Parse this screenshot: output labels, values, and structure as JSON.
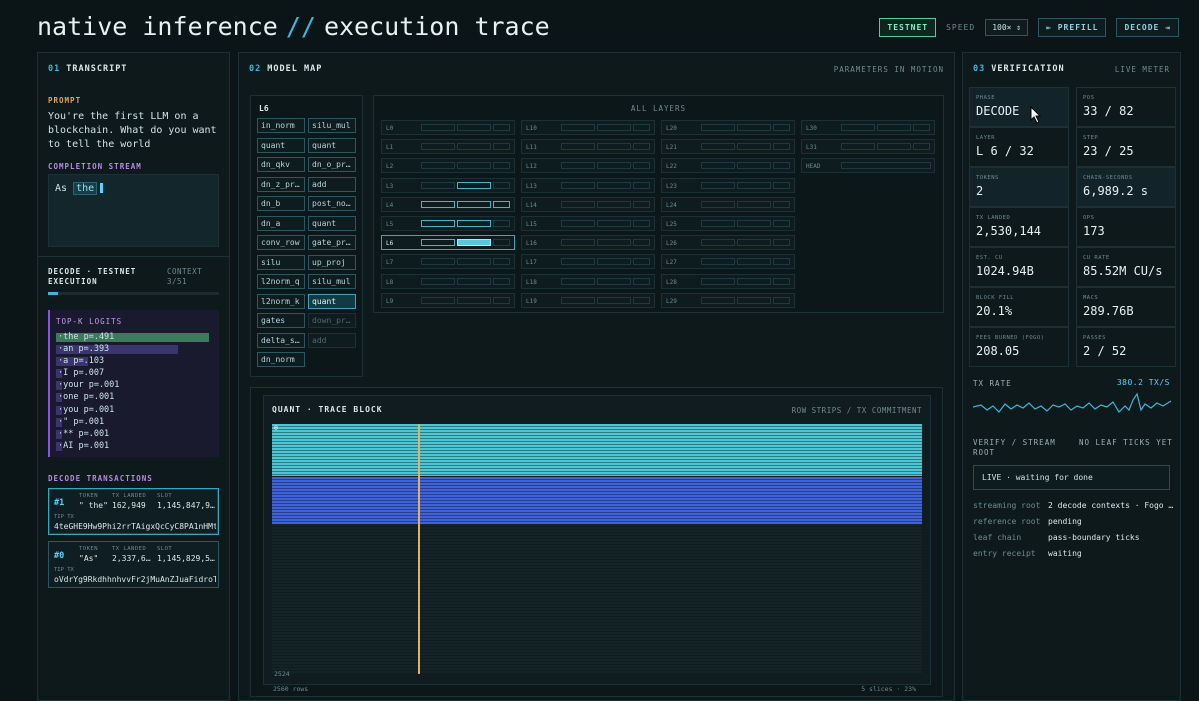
{
  "header": {
    "title_left": "native inference",
    "title_sep": "//",
    "title_right": "execution trace",
    "network": "TESTNET",
    "speed_label": "SPEED",
    "speed_value": "100× ⇕",
    "prefill_button": "⇤ PREFILL",
    "decode_button": "DECODE ⇥"
  },
  "transcript": {
    "num": "01",
    "title": "TRANSCRIPT",
    "prompt_label": "PROMPT",
    "prompt_text": "You're the first LLM on a blockchain. What do you want to tell the world",
    "completion_label": "COMPLETION STREAM",
    "completion_tokens": [
      "As",
      "the"
    ],
    "exec_label": "DECODE · TESTNET EXECUTION",
    "context_label": "CONTEXT",
    "context_value": "3/51",
    "context_fraction": 0.06,
    "topk_title": "TOP-K LOGITS",
    "topk": [
      {
        "text": "·the p=.491",
        "p": 0.491
      },
      {
        "text": "·an p=.393",
        "p": 0.393
      },
      {
        "text": "·a p=.103",
        "p": 0.103
      },
      {
        "text": "·I p=.007",
        "p": 0.007
      },
      {
        "text": "·your p=.001",
        "p": 0.001
      },
      {
        "text": "·one p=.001",
        "p": 0.001
      },
      {
        "text": "·you p=.001",
        "p": 0.001
      },
      {
        "text": "·\" p=.001",
        "p": 0.001
      },
      {
        "text": "·** p=.001",
        "p": 0.001
      },
      {
        "text": "·AI p=.001",
        "p": 0.001
      }
    ],
    "tx_label": "DECODE TRANSACTIONS",
    "tx_header_token": "TOKEN",
    "tx_header_landed": "TX LANDED",
    "tx_header_slot": "SLOT",
    "tx_header_tip": "TIP TX",
    "transactions": [
      {
        "idx": "#1",
        "token": "\" the\"",
        "landed": "162,949",
        "slot": "1,145,847,9…",
        "tip": "4teGHE9Hw9Phi2rrTAigxQcCyC8PA1nHMt"
      },
      {
        "idx": "#0",
        "token": "\"As\"",
        "landed": "2,337,6…",
        "slot": "1,145,829,5…",
        "tip": "oVdrYg9RkdhhnhvvFr2jMuAnZJuaFidroT"
      }
    ]
  },
  "model_map": {
    "num": "02",
    "title": "MODEL MAP",
    "subtitle": "PARAMETERS IN MOTION",
    "layer_title": "L6",
    "ops_left": [
      "in_norm",
      "quant",
      "dn_qkv",
      "dn_z_pr…",
      "dn_b",
      "dn_a",
      "conv_row",
      "silu",
      "l2norm_q",
      "l2norm_k",
      "gates",
      "delta_s…",
      "dn_norm"
    ],
    "ops_right": [
      "silu_mul",
      "quant",
      "dn_o_pr…",
      "add",
      "post_no…",
      "quant",
      "gate_pr…",
      "up_proj",
      "silu_mul",
      "quant",
      "down_pr…",
      "add"
    ],
    "all_layers_title": "ALL LAYERS",
    "layers": [
      "L0",
      "L1",
      "L2",
      "L3",
      "L4",
      "L5",
      "L6",
      "L7",
      "L8",
      "L9",
      "L10",
      "L11",
      "L12",
      "L13",
      "L14",
      "L15",
      "L16",
      "L17",
      "L18",
      "L19",
      "L20",
      "L21",
      "L22",
      "L23",
      "L24",
      "L25",
      "L26",
      "L27",
      "L28",
      "L29",
      "L30",
      "L31",
      "HEAD"
    ],
    "trace_title": "QUANT · TRACE BLOCK",
    "trace_subtitle": "ROW STRIPS / TX COMMITMENT",
    "trace_row_start": "0",
    "trace_row_end": "2524",
    "trace_rows": "2560 rows",
    "trace_slices": "5 slices · 23%"
  },
  "verification": {
    "num": "03",
    "title": "VERIFICATION",
    "subtitle": "LIVE METER",
    "metrics": [
      {
        "k": "PHASE",
        "v": "DECODE"
      },
      {
        "k": "POS",
        "v": "33 / 82"
      },
      {
        "k": "LAYER",
        "v": "L 6 / 32"
      },
      {
        "k": "STEP",
        "v": "23 / 25"
      },
      {
        "k": "TOKENS",
        "v": "2"
      },
      {
        "k": "CHAIN-SECONDS",
        "v": "6,989.2 s"
      },
      {
        "k": "TX LANDED",
        "v": "2,530,144"
      },
      {
        "k": "OPS",
        "v": "173"
      },
      {
        "k": "EST. CU",
        "v": "1024.94B"
      },
      {
        "k": "CU RATE",
        "v": "85.52M CU/s"
      },
      {
        "k": "BLOCK FILL",
        "v": "20.1%"
      },
      {
        "k": "MACS",
        "v": "289.76B"
      },
      {
        "k": "FEES BURNED (FOGO)",
        "v": "208.05"
      },
      {
        "k": "PASSES",
        "v": "2 / 52"
      }
    ],
    "tx_rate_label": "TX RATE",
    "tx_rate_value": "380.2 TX/S",
    "verify_label": "VERIFY / STREAM ROOT",
    "leaf_label": "NO LEAF TICKS YET",
    "live_status": "LIVE · waiting for done",
    "details": [
      {
        "k": "streaming root",
        "v": "2 decode contexts · Fogo …"
      },
      {
        "k": "reference root",
        "v": "pending"
      },
      {
        "k": "leaf chain",
        "v": "pass-boundary ticks"
      },
      {
        "k": "entry receipt",
        "v": "waiting"
      }
    ]
  }
}
